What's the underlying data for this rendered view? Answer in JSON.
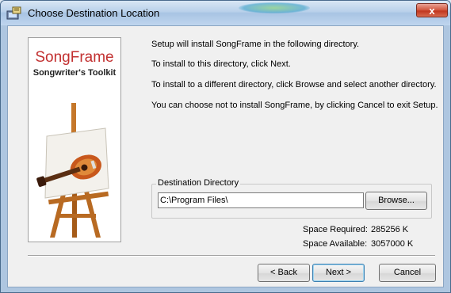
{
  "window": {
    "title": "Choose Destination Location",
    "close_label": "x"
  },
  "brand": {
    "name": "SongFrame",
    "tagline": "Songwriter's Toolkit"
  },
  "messages": [
    "Setup will install SongFrame in the following directory.",
    "To install to this directory, click Next.",
    "To install to a different directory, click Browse and select another directory.",
    "You can choose not to install SongFrame, by clicking Cancel to exit Setup."
  ],
  "destination": {
    "group_label": "Destination Directory",
    "path": "C:\\Program Files\\",
    "browse_label": "Browse..."
  },
  "space": {
    "required_label": "Space Required:",
    "required_value": "285256 K",
    "available_label": "Space Available:",
    "available_value": "3057000 K"
  },
  "buttons": {
    "back": "< Back",
    "next": "Next >",
    "cancel": "Cancel"
  }
}
